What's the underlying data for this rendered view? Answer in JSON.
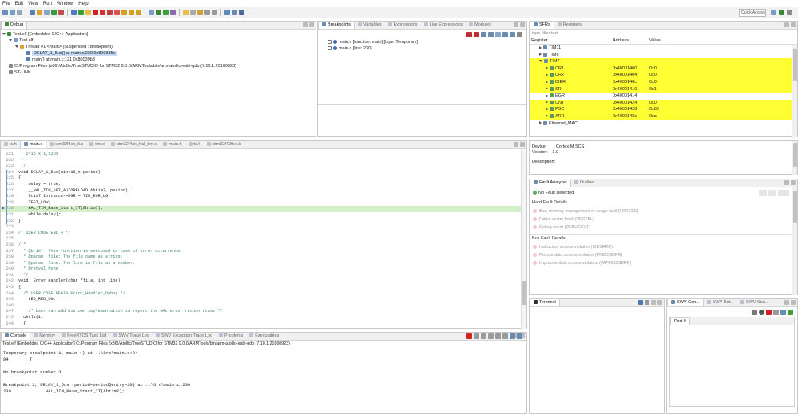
{
  "menu": [
    "File",
    "Edit",
    "View",
    "Run",
    "Window",
    "Help"
  ],
  "quick_access": "Quick Access",
  "debug": {
    "tab": "Debug",
    "rows": [
      "Test.elf [Embedded C/C++ Application]",
      "Test.elf",
      "Thread #1 <main> (Suspended : Breakpoint)",
      "DELAY_1_5us() at main.c:230 0x800385e",
      "main() at main.c:121 0x80039b8",
      "C:/Program Files (x86)/Atollic/TrueSTUDIO for STM32 9.0.0/ARMTools/bin/arm-atollic-eabi-gdb (7.10.1.20160923)",
      "ST-LINK"
    ]
  },
  "breakpoints": {
    "tabs": [
      "Breakpoints",
      "Variables",
      "Expressions",
      "Live Expressions",
      "Modules"
    ],
    "items": [
      "main.c [function: main] [type: Temporary]",
      "main.c [line: 230]"
    ]
  },
  "sfr": {
    "tabs": [
      "SFRs",
      "Registers"
    ],
    "filter_placeholder": "type filter text",
    "headers": [
      "Register",
      "Address",
      "Value"
    ],
    "rows": [
      {
        "name": "TIM11",
        "addr": "",
        "val": "",
        "hl": false,
        "indent": 1,
        "exp": "r"
      },
      {
        "name": "TIM6",
        "addr": "",
        "val": "",
        "hl": false,
        "indent": 1,
        "exp": "r"
      },
      {
        "name": "TIM7",
        "addr": "",
        "val": "",
        "hl": true,
        "indent": 1,
        "exp": "d"
      },
      {
        "name": "CR1",
        "addr": "0x40001400",
        "val": "0x0",
        "hl": true,
        "indent": 2,
        "exp": "r"
      },
      {
        "name": "CR2",
        "addr": "0x40001404",
        "val": "0x0",
        "hl": true,
        "indent": 2,
        "exp": "r"
      },
      {
        "name": "DIER",
        "addr": "0x4000140c",
        "val": "0x0",
        "hl": true,
        "indent": 2,
        "exp": "r"
      },
      {
        "name": "SR",
        "addr": "0x40001410",
        "val": "0x1",
        "hl": true,
        "indent": 2,
        "exp": "r"
      },
      {
        "name": "EGR",
        "addr": "0x40001414",
        "val": "",
        "hl": false,
        "indent": 2,
        "exp": "r"
      },
      {
        "name": "CNT",
        "addr": "0x40001424",
        "val": "0x0",
        "hl": true,
        "indent": 2,
        "exp": "r"
      },
      {
        "name": "PSC",
        "addr": "0x40001428",
        "val": "0x80",
        "hl": true,
        "indent": 2,
        "exp": "r"
      },
      {
        "name": "ARR",
        "addr": "0x4000142c",
        "val": "0xa",
        "hl": true,
        "indent": 2,
        "exp": "r"
      },
      {
        "name": "Ethernet_MAC",
        "addr": "",
        "val": "",
        "hl": false,
        "indent": 1,
        "exp": "r"
      }
    ],
    "device_label": "Device:",
    "device": "Cortex-M SCS",
    "version_label": "Version:",
    "version": "1.0",
    "description_label": "Description:"
  },
  "editor": {
    "tabs": [
      "tc.h",
      "main.c",
      "stm32f4xx_it.c",
      "tim.c",
      "stm32f4xx_hal_tim.c",
      "main.h",
      "tc.h",
      "stm32f429xx.h"
    ],
    "active_tab": 1,
    "lines": [
      {
        "n": "221",
        "t": " * 2^16 x 1,52µs",
        "c": "cm"
      },
      {
        "n": "222",
        "t": " *",
        "c": "cm"
      },
      {
        "n": "223",
        "t": " */",
        "c": "cm"
      },
      {
        "n": "224",
        "t": "void DELAY_1_5us(uint16_t period)",
        "c": "fn"
      },
      {
        "n": "225",
        "t": "{",
        "c": ""
      },
      {
        "n": "226",
        "t": "    delay = true;",
        "c": ""
      },
      {
        "n": "227",
        "t": "    __HAL_TIM_SET_AUTORELOAD(&htim7, period);",
        "c": ""
      },
      {
        "n": "228",
        "t": "    htim7.Instance->EGR = TIM_EGR_UG;",
        "c": ""
      },
      {
        "n": "229",
        "t": "    TEST_LOW;",
        "c": ""
      },
      {
        "n": "230",
        "t": "    HAL_TIM_Base_Start_IT(&htim7);",
        "c": "cur"
      },
      {
        "n": "231",
        "t": "    while(delay);",
        "c": "kwl"
      },
      {
        "n": "232",
        "t": "}",
        "c": ""
      },
      {
        "n": "233",
        "t": "",
        "c": ""
      },
      {
        "n": "234",
        "t": "/* USER CODE END 4 */",
        "c": "cm"
      },
      {
        "n": "235",
        "t": "",
        "c": ""
      },
      {
        "n": "236",
        "t": "/**",
        "c": "cm"
      },
      {
        "n": "237",
        "t": "  * @brief  This function is executed in case of error occurrence.",
        "c": "cm"
      },
      {
        "n": "238",
        "t": "  * @param  file: The file name as string.",
        "c": "cm"
      },
      {
        "n": "239",
        "t": "  * @param  line: The line in file as a number.",
        "c": "cm"
      },
      {
        "n": "240",
        "t": "  * @retval None",
        "c": "cm"
      },
      {
        "n": "241",
        "t": "  */",
        "c": "cm"
      },
      {
        "n": "242",
        "t": "void _Error_Handler(char *file, int line)",
        "c": "fn"
      },
      {
        "n": "243",
        "t": "{",
        "c": ""
      },
      {
        "n": "244",
        "t": "  /* USER CODE BEGIN Error_Handler_Debug */",
        "c": "cm"
      },
      {
        "n": "245",
        "t": "    LED_RED_ON;",
        "c": ""
      },
      {
        "n": "246",
        "t": "",
        "c": ""
      },
      {
        "n": "247",
        "t": "    /* User can add his own implementation to report the HAL error return state */",
        "c": "cm"
      },
      {
        "n": "248",
        "t": "  while(1)",
        "c": "kwl"
      },
      {
        "n": "249",
        "t": "  {",
        "c": ""
      }
    ]
  },
  "fault": {
    "tabs": [
      "Fault Analyzer",
      "Outline"
    ],
    "status": "No Fault Detected",
    "hard_title": "Hard Fault Details",
    "hard": [
      "Bus, memory management or usage fault (FORCED)",
      "Failed vector fetch (VECTBL)",
      "Debug event (DEBUGEVT)"
    ],
    "bus_title": "Bus Fault Details",
    "bus": [
      "Instruction access violation (IBUSERR)",
      "Precise data access violation (PRECISERR)",
      "Imprecise data access violation (IMPRECISERR)"
    ]
  },
  "console": {
    "tabs": [
      "Console",
      "Memory",
      "FreeRTOS Task List",
      "SWV Trace Log",
      "SWV Exception Trace Log",
      "Problems",
      "Executables"
    ],
    "header": "Test.elf [Embedded C/C++ Application] C:/Program Files (x86)/Atollic/TrueSTUDIO for STM32 9.0.0/ARMTools/bin/arm-atollic-eabi-gdb (7.10.1.20160923)",
    "lines": [
      "Temporary breakpoint 1, main () at ..\\Src\\main.c:84",
      "84        {",
      "",
      "No breakpoint number 3.",
      "",
      "Breakpoint 2, DELAY_1_5us (period=period@entry=10) at ..\\Src\\main.c:230",
      "230             HAL_TIM_Base_Start_IT(&htim7);"
    ]
  },
  "terminal": {
    "tab": "Terminal"
  },
  "swv": {
    "tabs": [
      "SWV Con...",
      "SWV Dat...",
      "SWV Stat..."
    ],
    "port": "Port 0"
  }
}
